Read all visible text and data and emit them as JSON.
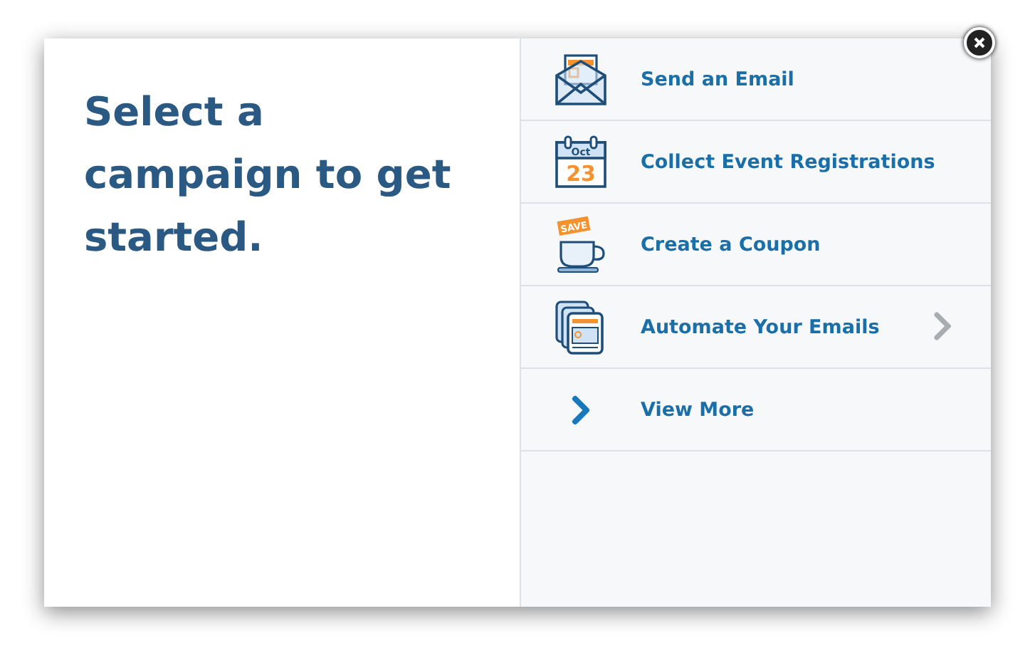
{
  "heading": "Select a campaign to get started.",
  "campaigns": [
    {
      "kind": "email",
      "label": "Send an Email",
      "chevron": false
    },
    {
      "kind": "calendar",
      "label": "Collect Event Registrations",
      "icon_texts": [
        "Oct",
        "23"
      ],
      "chevron": false
    },
    {
      "kind": "coupon",
      "label": "Create a Coupon",
      "icon_texts": [
        "SAVE"
      ],
      "chevron": false
    },
    {
      "kind": "automation",
      "label": "Automate Your Emails",
      "chevron": true
    },
    {
      "kind": "more",
      "label": "View More",
      "chevron": false
    }
  ]
}
